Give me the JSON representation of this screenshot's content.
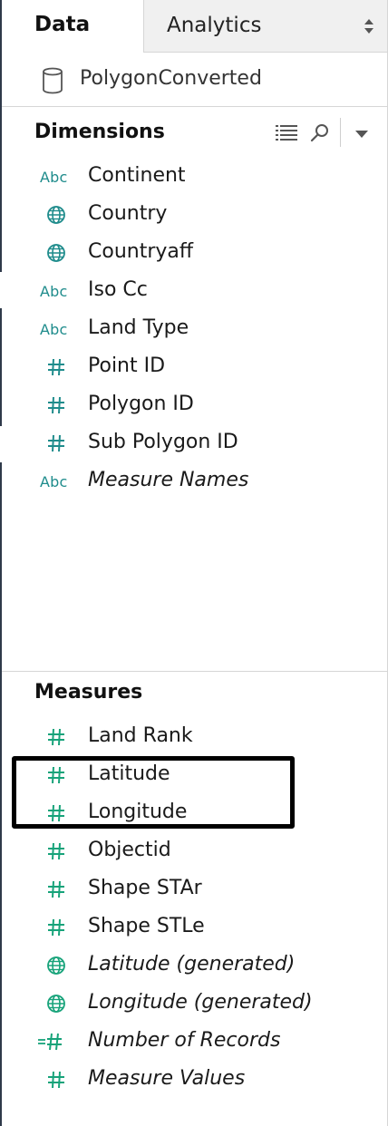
{
  "tabs": {
    "data": "Data",
    "analytics": "Analytics"
  },
  "datasource": {
    "name": "PolygonConverted",
    "icon": "database-icon"
  },
  "dimensions": {
    "title": "Dimensions",
    "fields": [
      {
        "type": "string",
        "label": "Continent",
        "italic": false
      },
      {
        "type": "geo",
        "label": "Country",
        "italic": false
      },
      {
        "type": "geo",
        "label": "Countryaff",
        "italic": false
      },
      {
        "type": "string",
        "label": "Iso Cc",
        "italic": false
      },
      {
        "type": "string",
        "label": "Land Type",
        "italic": false
      },
      {
        "type": "number",
        "label": "Point ID",
        "italic": false
      },
      {
        "type": "number",
        "label": "Polygon ID",
        "italic": false
      },
      {
        "type": "number",
        "label": "Sub Polygon ID",
        "italic": false
      },
      {
        "type": "string",
        "label": "Measure Names",
        "italic": true
      }
    ]
  },
  "measures": {
    "title": "Measures",
    "fields": [
      {
        "type": "number",
        "label": "Land Rank",
        "italic": false
      },
      {
        "type": "number",
        "label": "Latitude",
        "italic": false
      },
      {
        "type": "number",
        "label": "Longitude",
        "italic": false
      },
      {
        "type": "number",
        "label": "Objectid",
        "italic": false
      },
      {
        "type": "number",
        "label": "Shape STAr",
        "italic": false
      },
      {
        "type": "number",
        "label": "Shape STLe",
        "italic": false
      },
      {
        "type": "geo",
        "label": "Latitude (generated)",
        "italic": true
      },
      {
        "type": "geo",
        "label": "Longitude (generated)",
        "italic": true
      },
      {
        "type": "calc-number",
        "label": "Number of Records",
        "italic": true
      },
      {
        "type": "number",
        "label": "Measure Values",
        "italic": true
      }
    ]
  },
  "icons": {
    "string": "Abc",
    "number": "number-hash-icon",
    "geo": "globe-icon",
    "calc-number": "calculated-number-icon"
  },
  "colors": {
    "dimension_icon": "#1f8c8c",
    "measure_icon": "#17a37a",
    "highlight_border": "#000000"
  }
}
